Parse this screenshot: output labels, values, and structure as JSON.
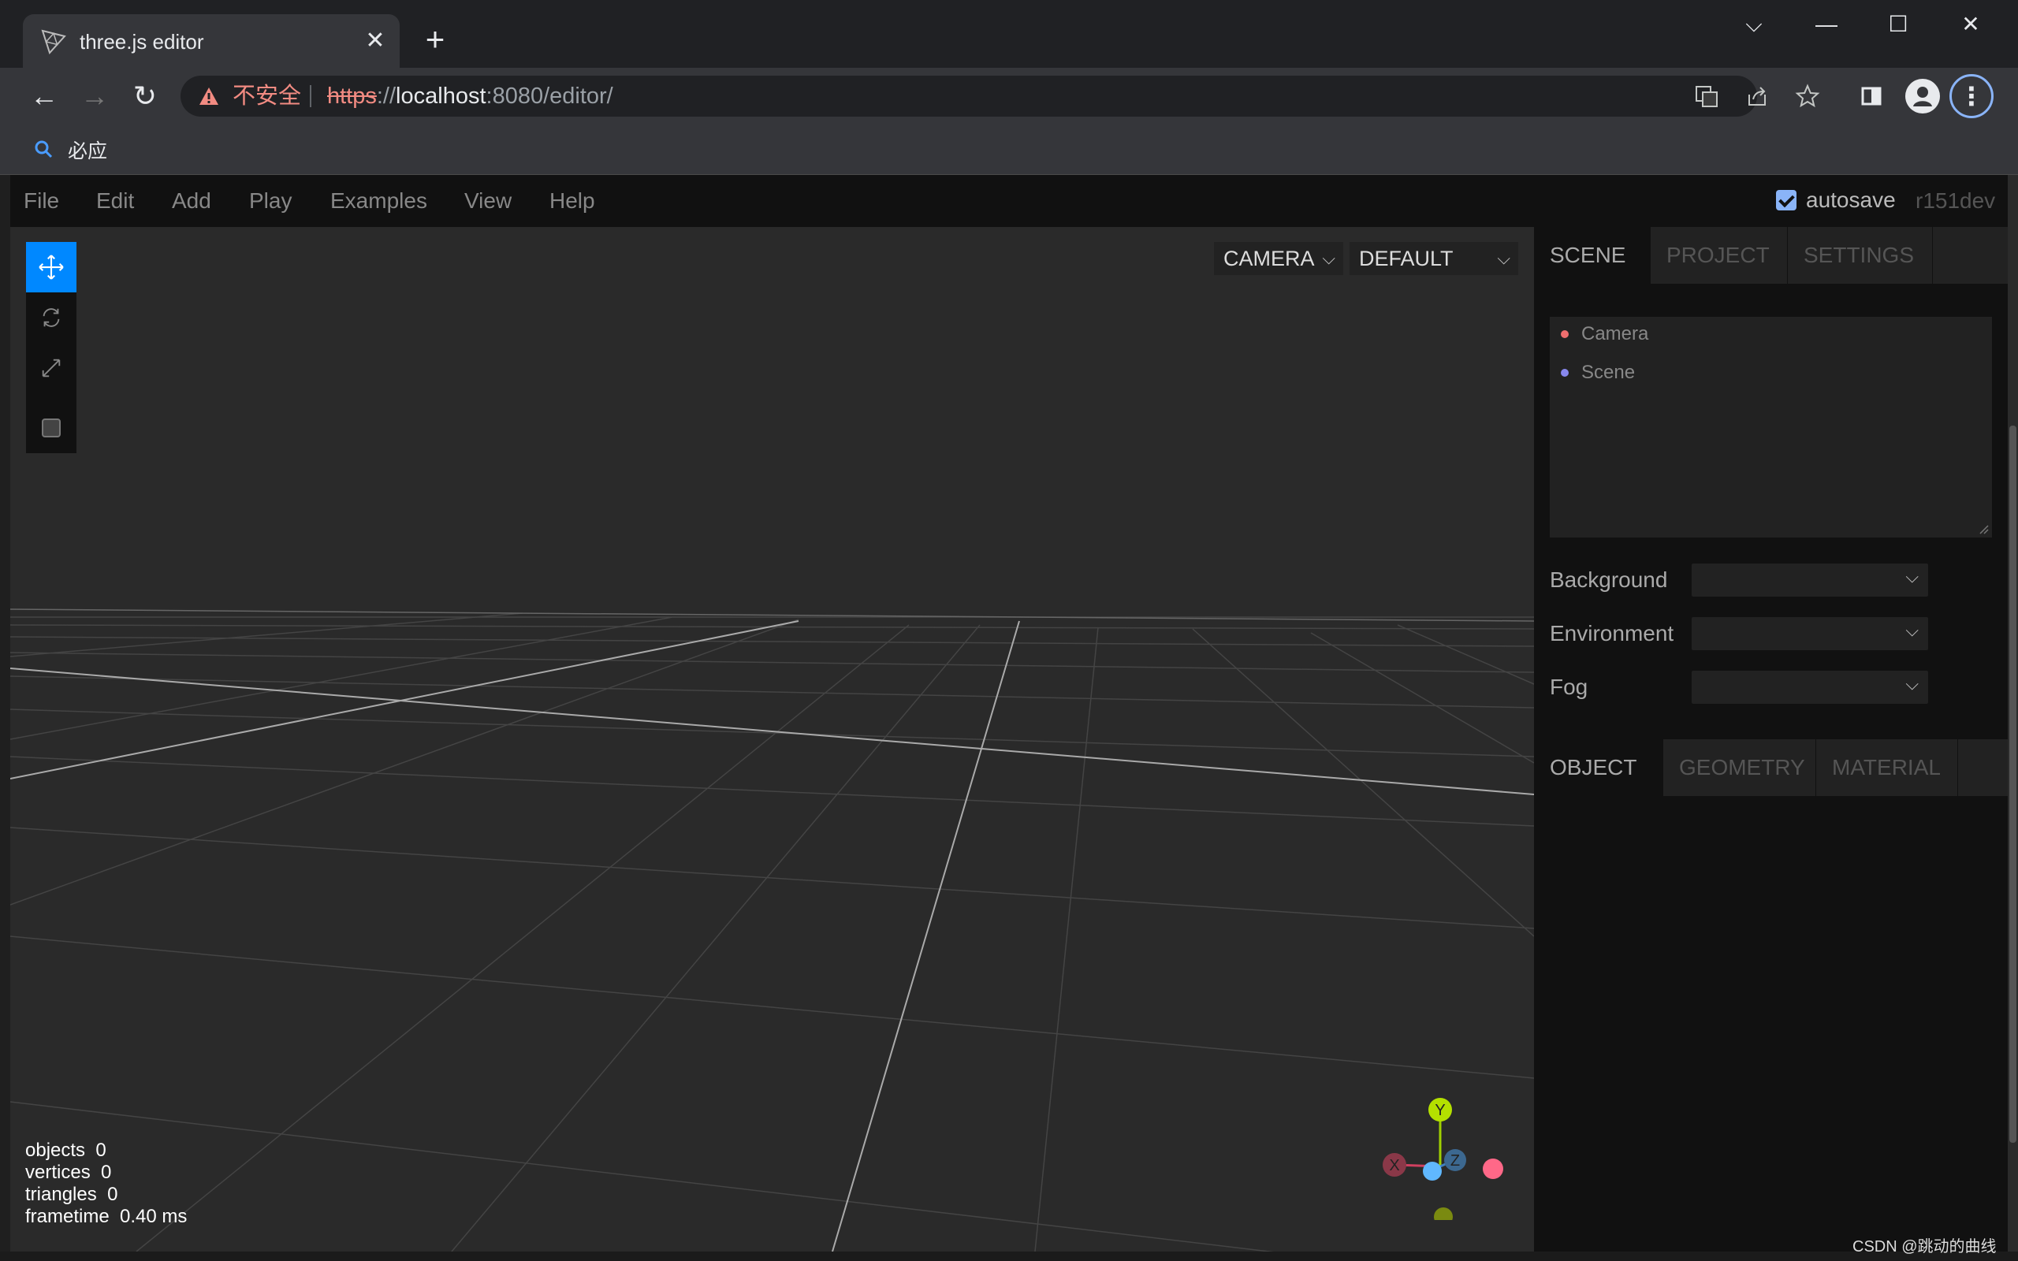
{
  "browser": {
    "tab_title": "three.js editor",
    "tab_close": "✕",
    "new_tab": "+",
    "window_controls": {
      "collapse": "⌵",
      "minimize": "—",
      "maximize": "☐",
      "close": "✕"
    },
    "nav": {
      "back": "←",
      "forward": "→",
      "reload": "↻"
    },
    "security_label": "不安全",
    "url": {
      "scheme": "https",
      "separator": "://",
      "host": "localhost",
      "rest": ":8080/editor/"
    },
    "bookmark": {
      "label": "必应",
      "icon": "search-icon"
    },
    "menu": "⋮"
  },
  "editor": {
    "menubar": [
      "File",
      "Edit",
      "Add",
      "Play",
      "Examples",
      "View",
      "Help"
    ],
    "autosave_label": "autosave",
    "autosave_checked": true,
    "version": "r151dev",
    "viewport": {
      "camera_select": "CAMERA",
      "shading_select": "DEFAULT",
      "info": {
        "objects_label": "objects",
        "objects": "0",
        "vertices_label": "vertices",
        "vertices": "0",
        "triangles_label": "triangles",
        "triangles": "0",
        "frametime_label": "frametime",
        "frametime": "0.40 ms"
      },
      "gizmo": {
        "y": "Y",
        "x": "X",
        "z": "Z"
      }
    },
    "sidebar": {
      "tabs": [
        "SCENE",
        "PROJECT",
        "SETTINGS"
      ],
      "active_tab": "SCENE",
      "outliner": [
        {
          "label": "Camera",
          "color": "#ee6e6e"
        },
        {
          "label": "Scene",
          "color": "#8888ee"
        }
      ],
      "background_label": "Background",
      "environment_label": "Environment",
      "fog_label": "Fog",
      "properties_tabs": [
        "OBJECT",
        "GEOMETRY",
        "MATERIAL"
      ],
      "active_properties_tab": "OBJECT"
    }
  },
  "watermark": "CSDN @跳动的曲线"
}
